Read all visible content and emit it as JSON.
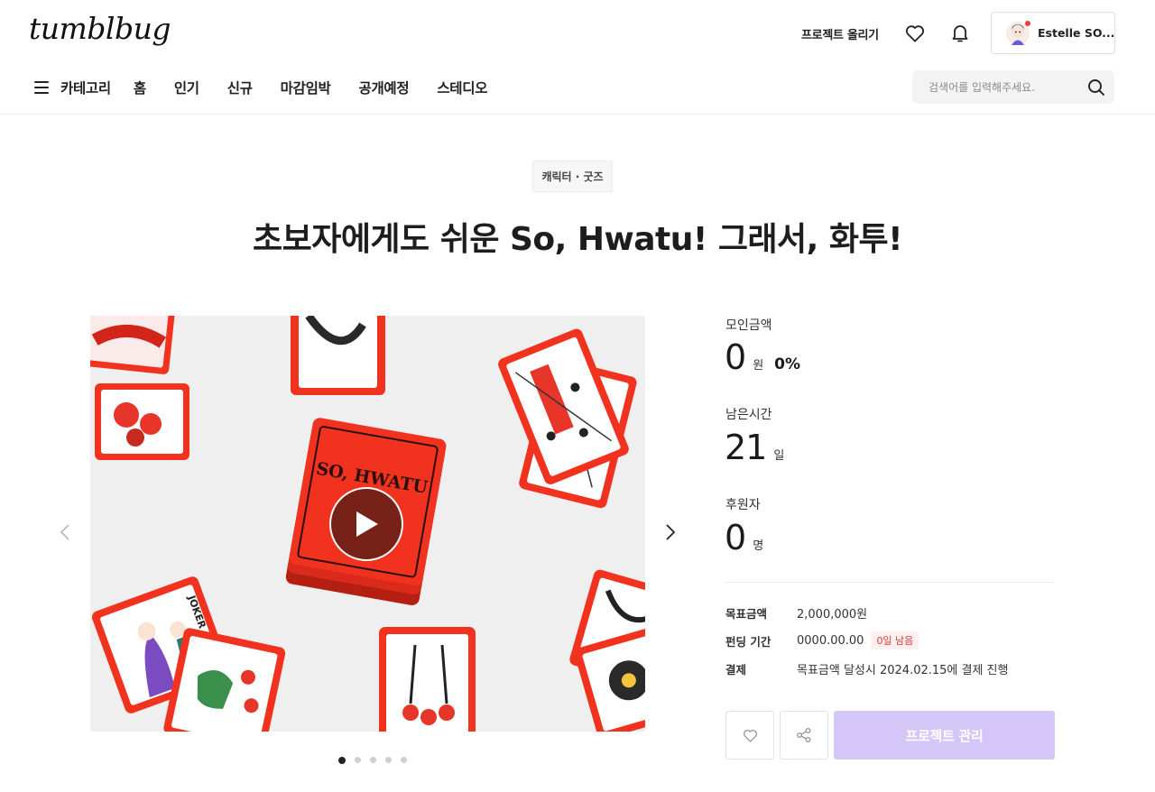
{
  "header": {
    "logo": "tumblbug",
    "upload_label": "프로젝트 올리기",
    "user_name": "Estelle SO..."
  },
  "nav": {
    "category_label": "카테고리",
    "items": [
      "홈",
      "인기",
      "신규",
      "마감임박",
      "공개예정",
      "스테디오"
    ]
  },
  "search": {
    "placeholder": "검색어를 입력해주세요."
  },
  "project": {
    "category": "캐릭터 · 굿즈",
    "title": "초보자에게도 쉬운 So, Hwatu! 그래서, 화투!"
  },
  "media": {
    "slide_count": 5,
    "active_slide": 1,
    "deck_text": "SO, HWATU",
    "card_text": "JOKER"
  },
  "stats": {
    "funding_label": "모인금액",
    "funding_value": "0",
    "funding_unit": "원",
    "funding_percent": "0%",
    "time_label": "남은시간",
    "time_value": "21",
    "time_unit": "일",
    "backers_label": "후원자",
    "backers_value": "0",
    "backers_unit": "명"
  },
  "details": {
    "goal_label": "목표금액",
    "goal_value": "2,000,000원",
    "period_label": "펀딩 기간",
    "period_value": "0000.00.00",
    "period_badge": "0일 남음",
    "payment_label": "결제",
    "payment_value": "목표금액 달성시 2024.02.15에 결제 진행"
  },
  "actions": {
    "manage_label": "프로젝트 관리"
  },
  "colors": {
    "accent": "#d5c6f8",
    "card_red": "#f0321f",
    "badge_red": "#e03c3c"
  }
}
